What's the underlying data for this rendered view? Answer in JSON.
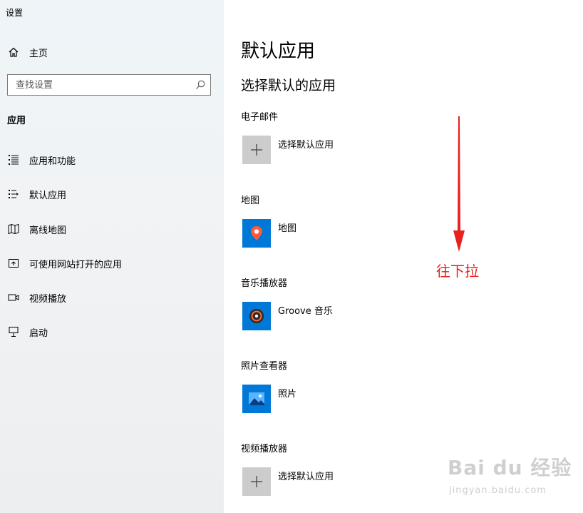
{
  "window": {
    "title": "设置"
  },
  "sidebar": {
    "home_label": "主页",
    "search_placeholder": "查找设置",
    "section_title": "应用",
    "items": [
      {
        "label": "应用和功能",
        "icon": "list-icon"
      },
      {
        "label": "默认应用",
        "icon": "default-apps-icon"
      },
      {
        "label": "离线地图",
        "icon": "map-icon"
      },
      {
        "label": "可使用网站打开的应用",
        "icon": "open-external-icon"
      },
      {
        "label": "视频播放",
        "icon": "video-icon"
      },
      {
        "label": "启动",
        "icon": "startup-icon"
      }
    ]
  },
  "main": {
    "title": "默认应用",
    "subtitle": "选择默认的应用",
    "categories": [
      {
        "label": "电子邮件",
        "app": "选择默认应用",
        "icon": "plus-icon"
      },
      {
        "label": "地图",
        "app": "地图",
        "icon": "maps-app-icon"
      },
      {
        "label": "音乐播放器",
        "app": "Groove 音乐",
        "icon": "groove-music-icon"
      },
      {
        "label": "照片查看器",
        "app": "照片",
        "icon": "photos-app-icon"
      },
      {
        "label": "视频播放器",
        "app": "选择默认应用",
        "icon": "plus-icon"
      }
    ]
  },
  "annotation": {
    "text": "往下拉",
    "color": "#e8201e"
  },
  "watermark": {
    "logo": "Bai du 经验",
    "url": "jingyan.baidu.com"
  },
  "colors": {
    "tile_blue": "#0078d7",
    "tile_gray": "#cccccc"
  }
}
